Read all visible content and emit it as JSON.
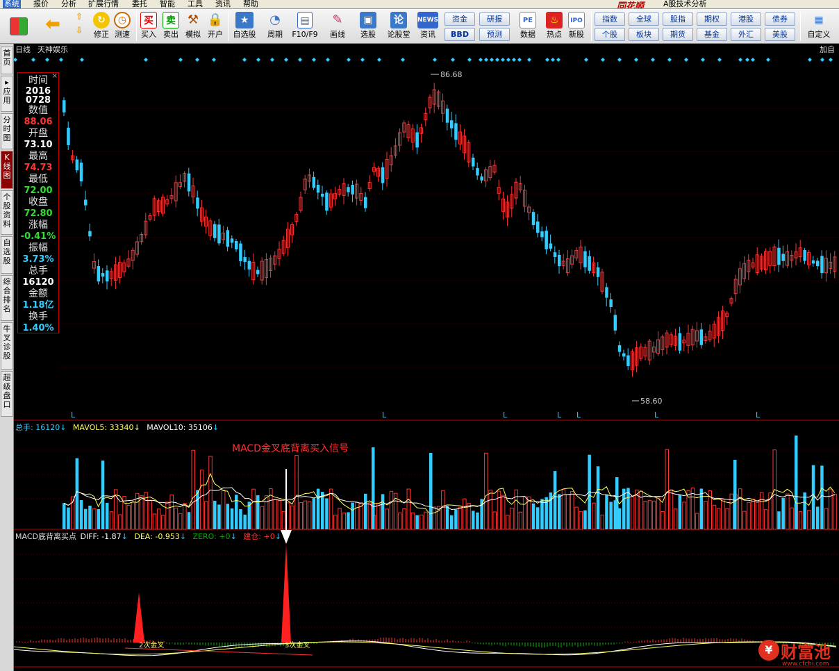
{
  "menu": {
    "items": [
      "系统",
      "报价",
      "分析",
      "扩展行情",
      "委托",
      "智能",
      "工具",
      "资讯",
      "帮助"
    ],
    "logo": "同花顺",
    "app_title": "A股技术分析"
  },
  "toolbar": {
    "buttons": [
      "修正",
      "测速",
      "买入",
      "卖出",
      "模拟",
      "开户",
      "自选股",
      "周期",
      "F10/F9",
      "画线",
      "选股",
      "论股堂",
      "资讯",
      "数据",
      "热点",
      "新股",
      "自定义"
    ],
    "icon_texts": {
      "buy": "买",
      "sell": "卖",
      "news": "NEWS",
      "lun": "论",
      "pe": "PE",
      "ipo": "IPO"
    },
    "small_buttons": [
      [
        "资金",
        "BBD"
      ],
      [
        "研报",
        "预测"
      ]
    ],
    "market_buttons": [
      [
        "指数",
        "个股"
      ],
      [
        "全球",
        "板块"
      ],
      [
        "股指",
        "期货"
      ],
      [
        "期权",
        "基金"
      ],
      [
        "港股",
        "外汇"
      ],
      [
        "债券",
        "美股"
      ]
    ]
  },
  "left_tabs": [
    "首页",
    "应用",
    "分时图",
    "K线图",
    "个股资料",
    "自选股",
    "综合排名",
    "牛叉诊股",
    "超级盘口"
  ],
  "left_tab_prefix": "▸",
  "chart": {
    "period_label": "日线",
    "stock_name": "天神娱乐",
    "corner_text": "加自",
    "high_label": "86.68",
    "low_label": "58.60",
    "l_marker": "L",
    "info": {
      "time_label": "时间",
      "time_year": "2016",
      "time_date": "0728",
      "value_label": "数值",
      "value": "88.06",
      "open_label": "开盘",
      "open": "73.10",
      "high_label": "最高",
      "high": "74.73",
      "low_label": "最低",
      "low": "72.00",
      "close_label": "收盘",
      "close": "72.80",
      "change_label": "涨幅",
      "change": "-0.41%",
      "amplitude_label": "振幅",
      "amplitude": "3.73%",
      "volume_label": "总手",
      "volume": "16120",
      "amount_label": "金额",
      "amount": "1.18亿",
      "turnover_label": "换手",
      "turnover": "1.40%",
      "close_btn": "×"
    },
    "volume_panel": {
      "legend": [
        {
          "name": "总手",
          "value": "16120",
          "color": "#33ccff"
        },
        {
          "name": "MAVOL5",
          "value": "33340",
          "color": "#ffff66"
        },
        {
          "name": "MAVOL10",
          "value": "35106",
          "color": "#ffffff"
        }
      ],
      "annotation": "MACD金叉底背离买入信号"
    },
    "macd_panel": {
      "title": "MACD底背离买点",
      "legend": [
        {
          "name": "DIFF",
          "value": "-1.87",
          "color": "#ffffff"
        },
        {
          "name": "DEA",
          "value": "-0.953",
          "color": "#ffff66"
        },
        {
          "name": "ZERO",
          "value": "+0",
          "color": "#00aa00"
        },
        {
          "name": "建仓",
          "value": "+0",
          "color": "#ff3333"
        }
      ],
      "signal1": "2次金叉",
      "signal2": "3次金叉"
    },
    "arrow": "↓",
    "colors": {
      "up": "#ff3333",
      "down": "#33ccff",
      "border": "#c00000",
      "marker": "#33ccff"
    }
  },
  "watermark": {
    "text": "财富池",
    "url": "www.cfchi.com"
  }
}
